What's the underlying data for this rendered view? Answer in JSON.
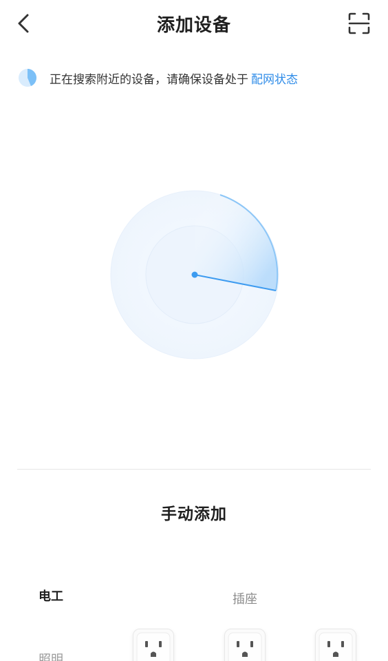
{
  "header": {
    "title": "添加设备",
    "back_icon": "chevron-left-icon",
    "scan_icon": "scan-icon"
  },
  "status": {
    "text": "正在搜索附近的设备，请确保设备处于",
    "link": "配网状态",
    "link_color": "#2f8ce8"
  },
  "radar": {
    "accent": "#3d9bf0",
    "light": "#eef5fd"
  },
  "manual": {
    "title": "手动添加"
  },
  "categories": [
    {
      "label": "电工",
      "active": true
    },
    {
      "label": "照明",
      "active": false
    }
  ],
  "section": {
    "label": "插座"
  },
  "devices": [
    {
      "icon": "socket-icon"
    },
    {
      "icon": "socket-icon"
    },
    {
      "icon": "socket-icon"
    }
  ]
}
